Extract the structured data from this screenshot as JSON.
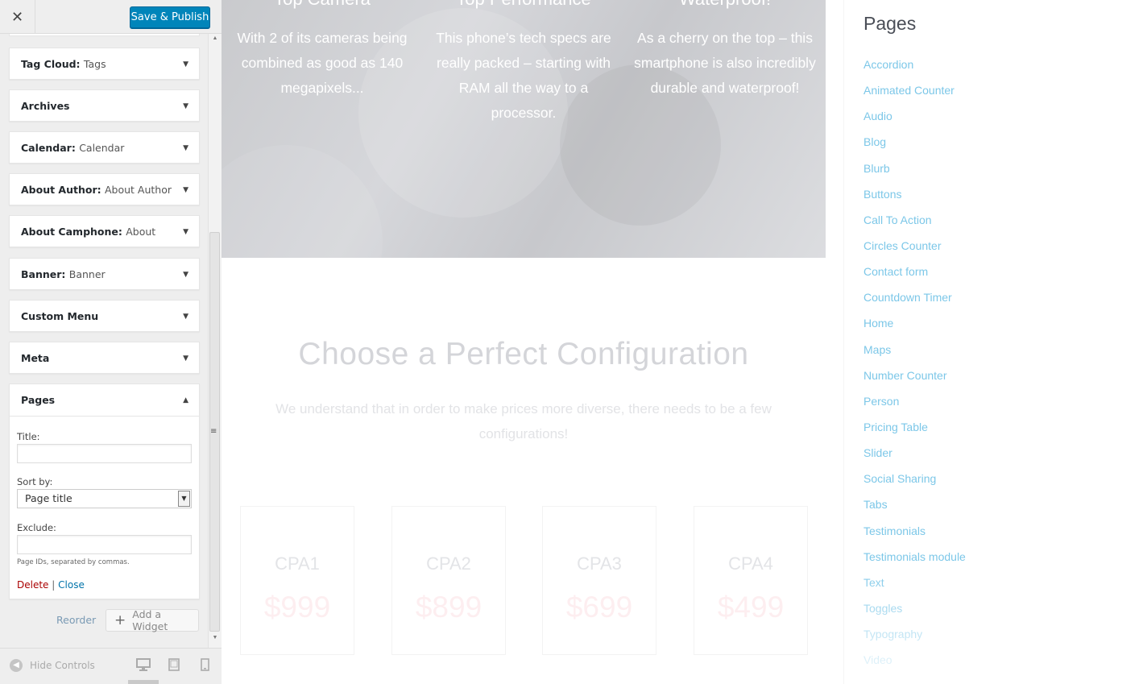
{
  "topbar": {
    "close_glyph": "✕",
    "publish_label": "Save & Publish"
  },
  "widgets": [
    {
      "name": "Tag Cloud",
      "sep": ": ",
      "sub": "Tags"
    },
    {
      "name": "Archives",
      "sep": "",
      "sub": ""
    },
    {
      "name": "Calendar",
      "sep": ": ",
      "sub": "Calendar"
    },
    {
      "name": "About Author",
      "sep": ": ",
      "sub": "About Author"
    },
    {
      "name": "About Camphone",
      "sep": ": ",
      "sub": "About"
    },
    {
      "name": "Banner",
      "sep": ": ",
      "sub": "Banner"
    },
    {
      "name": "Custom Menu",
      "sep": "",
      "sub": ""
    },
    {
      "name": "Meta",
      "sep": "",
      "sub": ""
    }
  ],
  "pages_widget": {
    "name": "Pages",
    "title_label": "Title:",
    "title_value": "",
    "sort_label": "Sort by:",
    "sort_value": "Page title",
    "exclude_label": "Exclude:",
    "exclude_value": "",
    "exclude_desc": "Page IDs, separated by commas.",
    "delete_label": "Delete",
    "separator": "|",
    "close_label": "Close"
  },
  "actions": {
    "reorder_label": "Reorder",
    "add_widget_label": "Add a Widget"
  },
  "footer": {
    "hide_controls_label": "Hide Controls"
  },
  "hero": {
    "features": [
      {
        "title": "Top Camera",
        "desc": "With 2 of its cameras being combined as good as 140 megapixels..."
      },
      {
        "title": "Top Performance",
        "desc": "This phone’s tech specs are really packed – starting with RAM all the way to a processor."
      },
      {
        "title": "Waterproof!",
        "desc": "As a cherry on the top – this smartphone is also incredibly durable and waterproof!"
      }
    ]
  },
  "config": {
    "title": "Choose a Perfect Configuration",
    "description": "We understand that in order to make prices more diverse, there needs to be a few configurations!"
  },
  "pricing": [
    {
      "name": "CPA1",
      "price": "$999"
    },
    {
      "name": "CPA2",
      "price": "$899"
    },
    {
      "name": "CPA3",
      "price": "$699"
    },
    {
      "name": "CPA4",
      "price": "$499"
    }
  ],
  "sidebar_widget": {
    "heading": "Pages",
    "items": [
      "Accordion",
      "Animated Counter",
      "Audio",
      "Blog",
      "Blurb",
      "Buttons",
      "Call To Action",
      "Circles Counter",
      "Contact form",
      "Countdown Timer",
      "Home",
      "Maps",
      "Number Counter",
      "Person",
      "Pricing Table",
      "Slider",
      "Social Sharing",
      "Tabs",
      "Testimonials",
      "Testimonials module",
      "Text",
      "Toggles",
      "Typography",
      "Video"
    ]
  },
  "colors": {
    "publish_bg": "#0085ba",
    "link": "#7cc7e8",
    "delete": "#a00000"
  }
}
